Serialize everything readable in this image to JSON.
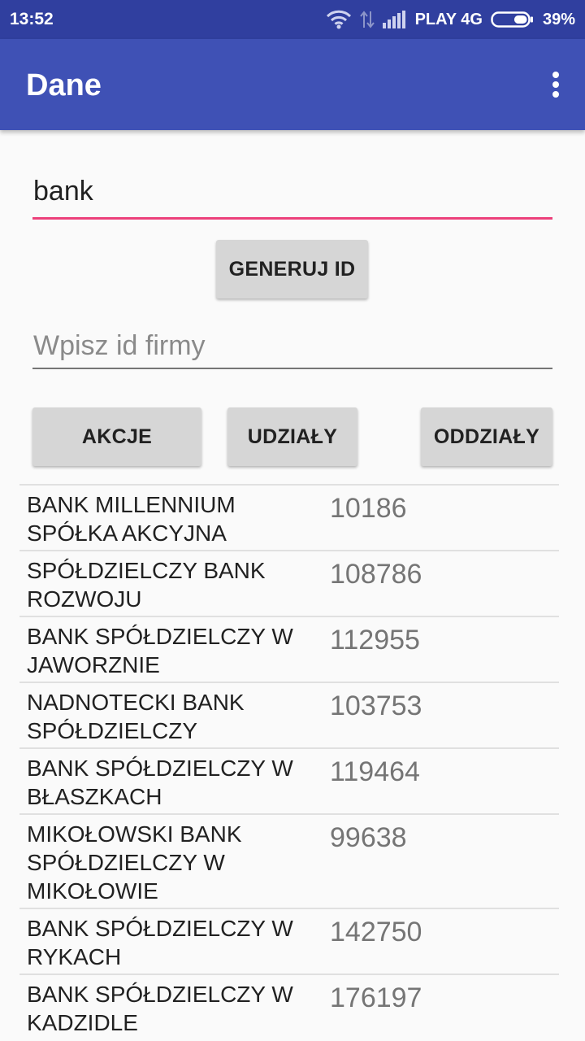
{
  "status": {
    "time": "13:52",
    "carrier": "PLAY 4G",
    "battery": "39%",
    "battery_level": 0.39
  },
  "app_bar": {
    "title": "Dane",
    "menu_icon": "more-vert-icon"
  },
  "search": {
    "value": "bank"
  },
  "generate_button": "GENERUJ ID",
  "id_field": {
    "placeholder": "Wpisz id firmy"
  },
  "actions": {
    "akcje": "AKCJE",
    "udzialy": "UDZIAŁY",
    "oddzialy": "ODDZIAŁY"
  },
  "results": [
    {
      "name": "BANK MILLENNIUM SPÓŁKA AKCYJNA",
      "id": "10186"
    },
    {
      "name": "SPÓŁDZIELCZY BANK ROZWOJU",
      "id": "108786"
    },
    {
      "name": "BANK SPÓŁDZIELCZY W JAWORZNIE",
      "id": "112955"
    },
    {
      "name": "NADNOTECKI BANK SPÓŁDZIELCZY",
      "id": "103753"
    },
    {
      "name": "BANK SPÓŁDZIELCZY W BŁASZKACH",
      "id": "119464"
    },
    {
      "name": "MIKOŁOWSKI BANK SPÓŁDZIELCZY W MIKOŁOWIE",
      "id": "99638"
    },
    {
      "name": "BANK SPÓŁDZIELCZY W RYKACH",
      "id": "142750"
    },
    {
      "name": "BANK SPÓŁDZIELCZY W KADZIDLE",
      "id": "176197"
    }
  ],
  "colors": {
    "status_bar": "#303f9f",
    "app_bar": "#3f51b5",
    "accent": "#ec407a"
  }
}
